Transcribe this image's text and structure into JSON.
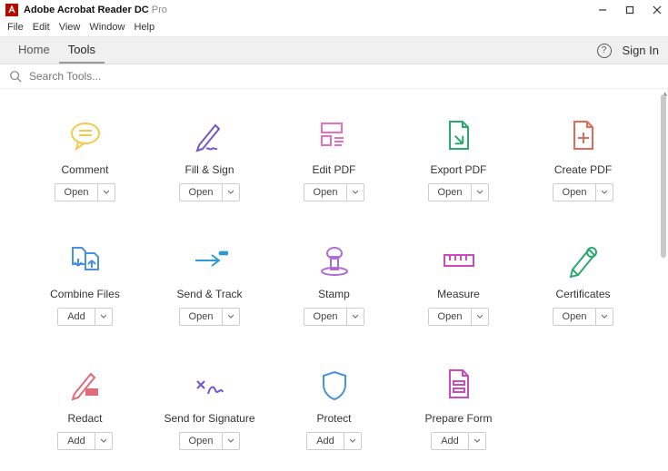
{
  "titlebar": {
    "app_name": "Adobe Acrobat Reader DC",
    "suffix": "Pro"
  },
  "menubar": [
    "File",
    "Edit",
    "View",
    "Window",
    "Help"
  ],
  "tabs": {
    "home": "Home",
    "tools": "Tools",
    "signin": "Sign In"
  },
  "search": {
    "placeholder": "Search Tools..."
  },
  "buttons": {
    "open": "Open",
    "add": "Add"
  },
  "tools": [
    {
      "name": "Comment",
      "action": "open",
      "icon": "comment",
      "color": "#f5c94b"
    },
    {
      "name": "Fill & Sign",
      "action": "open",
      "icon": "fillsign",
      "color": "#6a5acd"
    },
    {
      "name": "Edit PDF",
      "action": "open",
      "icon": "editpdf",
      "color": "#e66fbf"
    },
    {
      "name": "Export PDF",
      "action": "open",
      "icon": "exportpdf",
      "color": "#2ba86f"
    },
    {
      "name": "Create PDF",
      "action": "open",
      "icon": "createpdf",
      "color": "#e06b5a"
    },
    {
      "name": "Combine Files",
      "action": "add",
      "icon": "combine",
      "color": "#4a90e2"
    },
    {
      "name": "Send & Track",
      "action": "open",
      "icon": "sendtrack",
      "color": "#2a9bd6"
    },
    {
      "name": "Stamp",
      "action": "open",
      "icon": "stamp",
      "color": "#b06bd6"
    },
    {
      "name": "Measure",
      "action": "open",
      "icon": "measure",
      "color": "#c94bbf"
    },
    {
      "name": "Certificates",
      "action": "open",
      "icon": "certificates",
      "color": "#2ba86f"
    },
    {
      "name": "Redact",
      "action": "add",
      "icon": "redact",
      "color": "#e06b7a"
    },
    {
      "name": "Send for Signature",
      "action": "open",
      "icon": "sendforsig",
      "color": "#6a5acd"
    },
    {
      "name": "Protect",
      "action": "add",
      "icon": "protect",
      "color": "#4a90e2"
    },
    {
      "name": "Prepare Form",
      "action": "add",
      "icon": "prepareform",
      "color": "#c94bbf"
    }
  ]
}
